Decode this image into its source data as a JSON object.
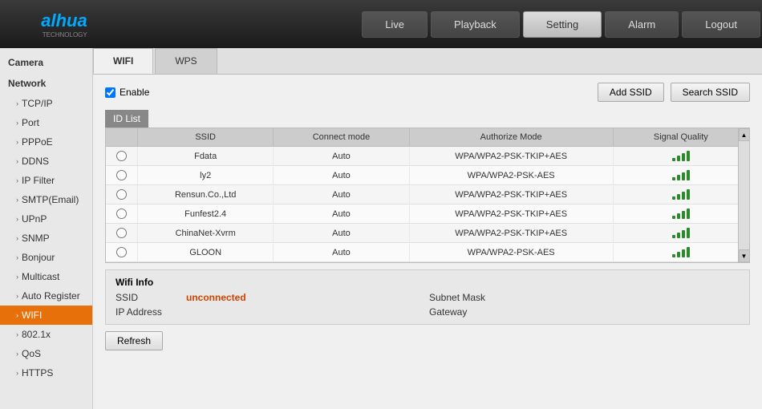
{
  "header": {
    "logo": "alhua",
    "logo_sub": "TECHNOLOGY",
    "nav": [
      {
        "id": "live",
        "label": "Live",
        "active": false
      },
      {
        "id": "playback",
        "label": "Playback",
        "active": false
      },
      {
        "id": "setting",
        "label": "Setting",
        "active": true
      },
      {
        "id": "alarm",
        "label": "Alarm",
        "active": false
      },
      {
        "id": "logout",
        "label": "Logout",
        "active": false
      }
    ]
  },
  "sidebar": {
    "sections": [
      {
        "label": "Camera",
        "items": []
      },
      {
        "label": "Network",
        "items": [
          {
            "id": "tcpip",
            "label": "TCP/IP"
          },
          {
            "id": "port",
            "label": "Port"
          },
          {
            "id": "pppoe",
            "label": "PPPoE"
          },
          {
            "id": "ddns",
            "label": "DDNS"
          },
          {
            "id": "ipfilter",
            "label": "IP Filter"
          },
          {
            "id": "smtp",
            "label": "SMTP(Email)"
          },
          {
            "id": "upnp",
            "label": "UPnP"
          },
          {
            "id": "snmp",
            "label": "SNMP"
          },
          {
            "id": "bonjour",
            "label": "Bonjour"
          },
          {
            "id": "multicast",
            "label": "Multicast"
          },
          {
            "id": "autoregister",
            "label": "Auto Register"
          },
          {
            "id": "wifi",
            "label": "WIFI",
            "active": true
          },
          {
            "id": "8021x",
            "label": "802.1x"
          },
          {
            "id": "qos",
            "label": "QoS"
          },
          {
            "id": "https",
            "label": "HTTPS"
          }
        ]
      }
    ]
  },
  "content": {
    "sub_tabs": [
      {
        "id": "wifi",
        "label": "WIFI",
        "active": true
      },
      {
        "id": "wps",
        "label": "WPS",
        "active": false
      }
    ],
    "enable_label": "Enable",
    "add_ssid_btn": "Add SSID",
    "search_ssid_btn": "Search SSID",
    "id_list_label": "ID List",
    "table": {
      "headers": [
        "",
        "SSID",
        "Connect mode",
        "Authorize Mode",
        "Signal Quality"
      ],
      "rows": [
        {
          "ssid": "Fdata",
          "connect_mode": "Auto",
          "auth_mode": "WPA/WPA2-PSK-TKIP+AES",
          "signal": 4
        },
        {
          "ssid": "ly2",
          "connect_mode": "Auto",
          "auth_mode": "WPA/WPA2-PSK-AES",
          "signal": 4
        },
        {
          "ssid": "Rensun.Co.,Ltd",
          "connect_mode": "Auto",
          "auth_mode": "WPA/WPA2-PSK-TKIP+AES",
          "signal": 4
        },
        {
          "ssid": "Funfest2.4",
          "connect_mode": "Auto",
          "auth_mode": "WPA/WPA2-PSK-TKIP+AES",
          "signal": 4
        },
        {
          "ssid": "ChinaNet-Xvrm",
          "connect_mode": "Auto",
          "auth_mode": "WPA/WPA2-PSK-TKIP+AES",
          "signal": 4
        },
        {
          "ssid": "GLOON",
          "connect_mode": "Auto",
          "auth_mode": "WPA/WPA2-PSK-AES",
          "signal": 4
        }
      ]
    },
    "wifi_info": {
      "title": "Wifi Info",
      "ssid_label": "SSID",
      "ssid_value": "unconnected",
      "ip_label": "IP Address",
      "ip_value": "",
      "subnet_label": "Subnet Mask",
      "subnet_value": "",
      "gateway_label": "Gateway",
      "gateway_value": ""
    },
    "refresh_btn": "Refresh"
  }
}
